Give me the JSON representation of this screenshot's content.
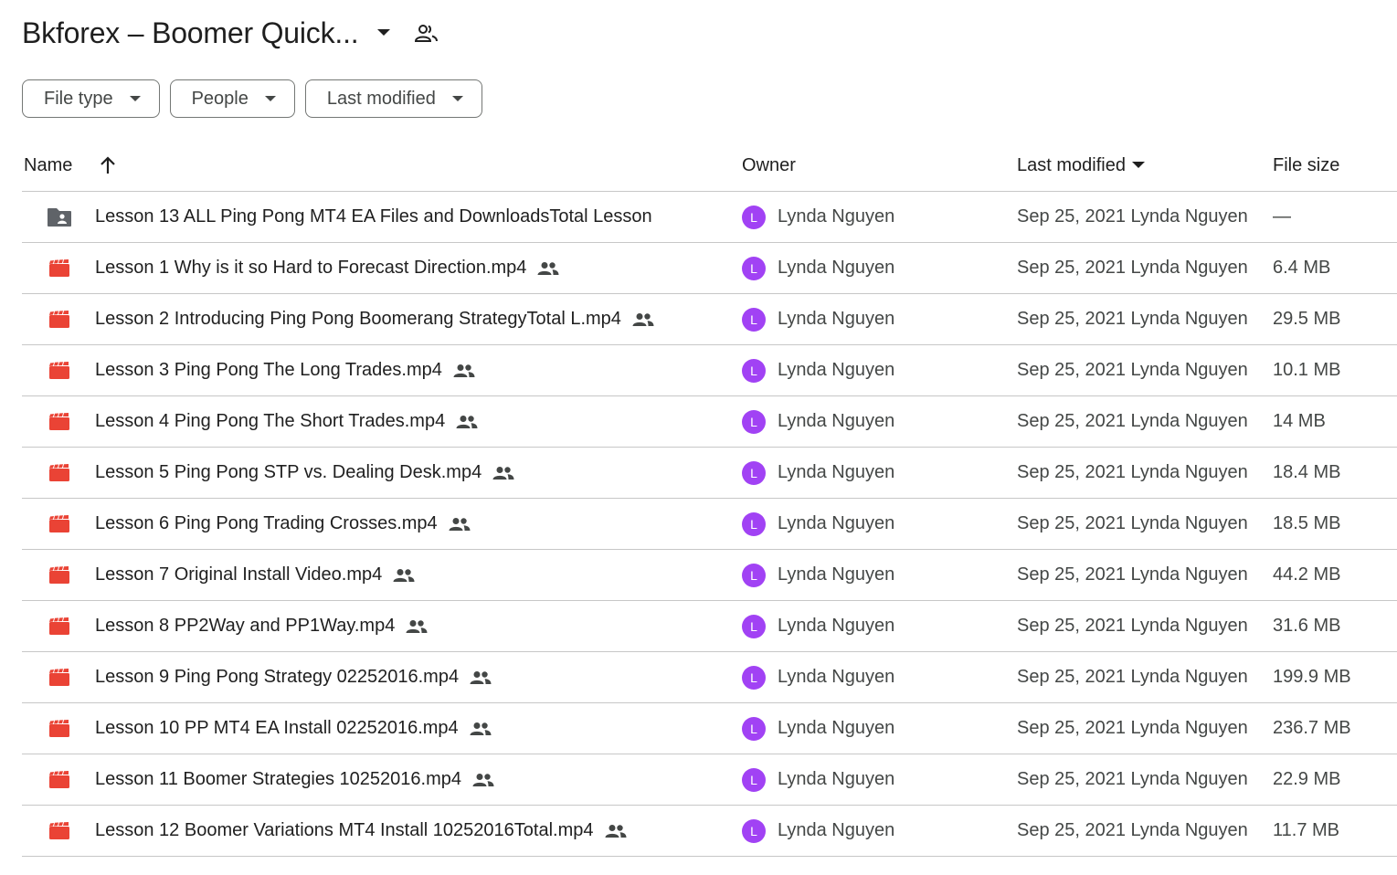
{
  "header": {
    "title": "Bkforex – Boomer Quick..."
  },
  "filters": [
    {
      "label": "File type"
    },
    {
      "label": "People"
    },
    {
      "label": "Last modified"
    }
  ],
  "columns": {
    "name": "Name",
    "owner": "Owner",
    "last_modified": "Last modified",
    "file_size": "File size"
  },
  "colors": {
    "video_icon": "#ea4335",
    "folder_icon": "#5f6368",
    "avatar": "#a142f4"
  },
  "rows": [
    {
      "icon": "shared-folder-icon",
      "name": "Lesson 13 ALL Ping Pong MT4 EA Files and DownloadsTotal Lesson",
      "shared": false,
      "owner_initial": "L",
      "owner": "Lynda Nguyen",
      "modified": "Sep 25, 2021 Lynda Nguyen",
      "size": "—"
    },
    {
      "icon": "video-file-icon",
      "name": "Lesson 1 Why is it so Hard to Forecast Direction.mp4",
      "shared": true,
      "owner_initial": "L",
      "owner": "Lynda Nguyen",
      "modified": "Sep 25, 2021 Lynda Nguyen",
      "size": "6.4 MB"
    },
    {
      "icon": "video-file-icon",
      "name": "Lesson 2 Introducing Ping Pong Boomerang StrategyTotal L.mp4",
      "shared": true,
      "owner_initial": "L",
      "owner": "Lynda Nguyen",
      "modified": "Sep 25, 2021 Lynda Nguyen",
      "size": "29.5 MB"
    },
    {
      "icon": "video-file-icon",
      "name": "Lesson 3 Ping Pong The Long Trades.mp4",
      "shared": true,
      "owner_initial": "L",
      "owner": "Lynda Nguyen",
      "modified": "Sep 25, 2021 Lynda Nguyen",
      "size": "10.1 MB"
    },
    {
      "icon": "video-file-icon",
      "name": "Lesson 4 Ping Pong The Short Trades.mp4",
      "shared": true,
      "owner_initial": "L",
      "owner": "Lynda Nguyen",
      "modified": "Sep 25, 2021 Lynda Nguyen",
      "size": "14 MB"
    },
    {
      "icon": "video-file-icon",
      "name": "Lesson 5 Ping Pong STP vs. Dealing Desk.mp4",
      "shared": true,
      "owner_initial": "L",
      "owner": "Lynda Nguyen",
      "modified": "Sep 25, 2021 Lynda Nguyen",
      "size": "18.4 MB"
    },
    {
      "icon": "video-file-icon",
      "name": "Lesson 6 Ping Pong Trading Crosses.mp4",
      "shared": true,
      "owner_initial": "L",
      "owner": "Lynda Nguyen",
      "modified": "Sep 25, 2021 Lynda Nguyen",
      "size": "18.5 MB"
    },
    {
      "icon": "video-file-icon",
      "name": "Lesson 7 Original Install Video.mp4",
      "shared": true,
      "owner_initial": "L",
      "owner": "Lynda Nguyen",
      "modified": "Sep 25, 2021 Lynda Nguyen",
      "size": "44.2 MB"
    },
    {
      "icon": "video-file-icon",
      "name": "Lesson 8 PP2Way and PP1Way.mp4",
      "shared": true,
      "owner_initial": "L",
      "owner": "Lynda Nguyen",
      "modified": "Sep 25, 2021 Lynda Nguyen",
      "size": "31.6 MB"
    },
    {
      "icon": "video-file-icon",
      "name": "Lesson 9 Ping Pong Strategy 02252016.mp4",
      "shared": true,
      "owner_initial": "L",
      "owner": "Lynda Nguyen",
      "modified": "Sep 25, 2021 Lynda Nguyen",
      "size": "199.9 MB"
    },
    {
      "icon": "video-file-icon",
      "name": "Lesson 10 PP MT4 EA Install 02252016.mp4",
      "shared": true,
      "owner_initial": "L",
      "owner": "Lynda Nguyen",
      "modified": "Sep 25, 2021 Lynda Nguyen",
      "size": "236.7 MB"
    },
    {
      "icon": "video-file-icon",
      "name": "Lesson 11 Boomer Strategies 10252016.mp4",
      "shared": true,
      "owner_initial": "L",
      "owner": "Lynda Nguyen",
      "modified": "Sep 25, 2021 Lynda Nguyen",
      "size": "22.9 MB"
    },
    {
      "icon": "video-file-icon",
      "name": "Lesson 12 Boomer Variations MT4 Install 10252016Total.mp4",
      "shared": true,
      "owner_initial": "L",
      "owner": "Lynda Nguyen",
      "modified": "Sep 25, 2021 Lynda Nguyen",
      "size": "11.7 MB"
    }
  ]
}
